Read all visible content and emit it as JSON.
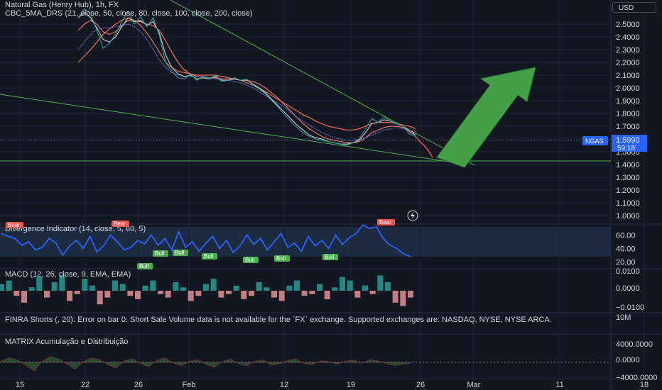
{
  "main": {
    "title": "Natural Gas (Henry Hub), 1h, FX",
    "indicator": "CBC_5MA_DRS (21, close, 50, close, 80, close, 100, close, 200, close)",
    "currency": "USD",
    "ticker": "NGAS",
    "last_price": "1.5990",
    "countdown": "59:18"
  },
  "panes": {
    "divergence": "Divergence Indicator (14, close, 5, 60, 5)",
    "macd": "MACD (12, 26, close, 9, EMA, EMA)",
    "finra": "FINRA Shorts (, 20): Error on bar 0: Short Sale Volume data is not available for the `FX` exchange. Supported exchanges are: NASDAQ, NYSE, NYSE ARCA.",
    "matrix": "MATRIX Acumulação e Distribuição"
  },
  "labels": {
    "bear": "Bear",
    "bull": "Bull"
  },
  "chart_data": {
    "type": "line",
    "price_axis": [
      "2.5000",
      "2.4000",
      "2.3000",
      "2.2000",
      "2.1000",
      "2.0000",
      "1.9000",
      "1.8000",
      "1.7000",
      "1.6000",
      "1.5000",
      "1.4000",
      "1.3000",
      "1.2000",
      "1.1000",
      "1.0000"
    ],
    "ylim": [
      0.9,
      2.6
    ],
    "osc_axis": [
      "60.00",
      "40.00",
      "20.00"
    ],
    "macd_axis": [
      "0.0100",
      "0.0000",
      "−0.0100"
    ],
    "finra_axis": [
      "10M"
    ],
    "matrix_axis": [
      "4000.0000",
      "0.0000",
      "−4000.0000"
    ],
    "x_ticks": [
      "15",
      "22",
      "26",
      "Feb",
      "12",
      "19",
      "26",
      "Mar",
      "11",
      "18"
    ],
    "price_series": {
      "name": "Natural Gas (Henry Hub)",
      "values": [
        2.55,
        2.62,
        2.58,
        2.45,
        2.31,
        2.35,
        2.42,
        2.52,
        2.6,
        2.5,
        2.56,
        2.48,
        2.55,
        2.41,
        2.2,
        2.13,
        2.08,
        2.07,
        2.11,
        2.06,
        2.09,
        2.07,
        2.1,
        2.05,
        2.06,
        2.08,
        2.06,
        2.07,
        2.02,
        1.99,
        1.95,
        1.9,
        1.85,
        1.79,
        1.74,
        1.69,
        1.65,
        1.62,
        1.6,
        1.59,
        1.58,
        1.57,
        1.56,
        1.55,
        1.57,
        1.6,
        1.68,
        1.76,
        1.73,
        1.77,
        1.74,
        1.72,
        1.7,
        1.64,
        1.62
      ],
      "drop_tail": [
        1.62,
        1.58,
        1.55,
        1.51,
        1.455
      ]
    },
    "ma_series": [
      {
        "values": [
          2.45,
          2.5,
          2.53,
          2.5,
          2.44,
          2.42,
          2.44,
          2.49,
          2.53,
          2.52,
          2.52,
          2.5,
          2.49,
          2.45,
          2.37,
          2.28,
          2.2,
          2.14,
          2.11,
          2.09,
          2.09,
          2.08,
          2.08,
          2.07,
          2.07,
          2.07,
          2.06,
          2.06,
          2.05,
          2.03,
          2.0,
          1.96,
          1.92,
          1.87,
          1.82,
          1.77,
          1.72,
          1.68,
          1.65,
          1.62,
          1.6,
          1.59,
          1.58,
          1.57,
          1.57,
          1.58,
          1.61,
          1.65,
          1.67,
          1.69,
          1.7,
          1.7,
          1.69,
          1.67,
          1.64
        ],
        "color": "#e57373"
      },
      {
        "values": [
          2.3,
          2.36,
          2.42,
          2.46,
          2.47,
          2.47,
          2.48,
          2.49,
          2.5,
          2.48,
          2.44,
          2.38,
          2.3,
          2.22,
          2.16,
          2.12,
          2.1,
          2.09,
          2.09,
          2.09,
          2.09,
          2.08,
          2.07,
          2.06,
          2.06,
          2.05,
          2.04,
          2.02,
          2.0,
          1.97,
          1.94,
          1.91,
          1.88,
          1.85,
          1.81,
          1.77,
          1.74,
          1.71,
          1.68,
          1.65,
          1.63,
          1.61,
          1.6,
          1.59,
          1.59,
          1.6,
          1.61,
          1.63,
          1.65,
          1.67,
          1.68,
          1.69,
          1.68,
          1.67,
          1.66
        ],
        "color": "#5c6bc0"
      },
      {
        "values": [
          2.2,
          2.25,
          2.3,
          2.36,
          2.42,
          2.46,
          2.5,
          2.53,
          2.55,
          2.53,
          2.49,
          2.43,
          2.36,
          2.28,
          2.2,
          2.16,
          2.13,
          2.12,
          2.11,
          2.1,
          2.1,
          2.1,
          2.1,
          2.09,
          2.08,
          2.07,
          2.06,
          2.04,
          2.02,
          2.0,
          1.97,
          1.94,
          1.91,
          1.88,
          1.85,
          1.82,
          1.79,
          1.77,
          1.74,
          1.72,
          1.7,
          1.69,
          1.68,
          1.67,
          1.67,
          1.68,
          1.7,
          1.72,
          1.73,
          1.73,
          1.73,
          1.72,
          1.71,
          1.7,
          1.68
        ],
        "color": "#ef6c51"
      },
      {
        "values": [
          2.55,
          2.59,
          2.55,
          2.47,
          2.38,
          2.36,
          2.4,
          2.48,
          2.55,
          2.52,
          2.53,
          2.49,
          2.52,
          2.43,
          2.26,
          2.16,
          2.11,
          2.09,
          2.1,
          2.07,
          2.08,
          2.07,
          2.09,
          2.06,
          2.06,
          2.07,
          2.06,
          2.06,
          2.03,
          2.0,
          1.96,
          1.91,
          1.86,
          1.81,
          1.76,
          1.71,
          1.67,
          1.63,
          1.61,
          1.6,
          1.58,
          1.57,
          1.56,
          1.56,
          1.57,
          1.59,
          1.65,
          1.72,
          1.73,
          1.75,
          1.74,
          1.72,
          1.7,
          1.66,
          1.63
        ],
        "color": "#bdbdbd"
      }
    ],
    "trendlines": [
      {
        "from": [
          "15",
          2.9
        ],
        "to": [
          "Mar",
          1.4
        ],
        "color": "#4caf50"
      },
      {
        "from": [
          "15",
          1.95
        ],
        "to": [
          "Mar (approx)",
          1.43
        ],
        "color": "#4caf50"
      },
      {
        "horizontal": 1.44,
        "color": "#4caf50"
      }
    ],
    "oscillator": [
      62,
      58,
      55,
      45,
      50,
      38,
      42,
      55,
      48,
      30,
      44,
      52,
      40,
      58,
      35,
      44,
      60,
      50,
      38,
      42,
      52,
      47,
      60,
      45,
      55,
      38,
      65,
      42,
      50,
      36,
      48,
      58,
      40,
      52,
      34,
      44,
      60,
      46,
      55,
      38,
      50,
      62,
      42,
      48,
      36,
      58,
      44,
      52,
      40,
      60,
      46,
      56,
      62,
      75,
      70,
      72,
      55,
      45,
      40,
      32,
      28
    ],
    "macd_hist": [
      0.004,
      0.006,
      -0.003,
      -0.007,
      0.002,
      0.008,
      -0.004,
      0.005,
      0.009,
      -0.006,
      -0.002,
      0.007,
      0.003,
      -0.008,
      -0.004,
      0.006,
      0.004,
      -0.003,
      -0.005,
      0.003,
      0.006,
      -0.002,
      -0.004,
      0.005,
      0.002,
      -0.006,
      -0.003,
      0.004,
      0.007,
      -0.004,
      -0.002,
      0.003,
      -0.005,
      -0.003,
      0.005,
      0.002,
      -0.004,
      -0.006,
      0.003,
      0.006,
      -0.003,
      -0.002,
      0.004,
      -0.005,
      0.002,
      0.008,
      0.006,
      -0.004,
      0.003,
      -0.002,
      0.009,
      0.005,
      -0.007,
      -0.009,
      -0.004
    ],
    "matrix": [
      400,
      1200,
      600,
      -800,
      -2200,
      300,
      1500,
      900,
      -400,
      -1800,
      200,
      1100,
      700,
      -600,
      -1500,
      400,
      900,
      -300,
      -1100,
      500,
      1200,
      -200,
      -900,
      300,
      700,
      -500,
      -1300,
      200,
      800,
      -400,
      -900,
      300,
      600,
      -700,
      -400,
      500,
      900,
      -300,
      -600,
      400,
      200,
      -500,
      300,
      600,
      -200,
      700,
      400,
      -300,
      -800,
      -500,
      -200
    ]
  }
}
